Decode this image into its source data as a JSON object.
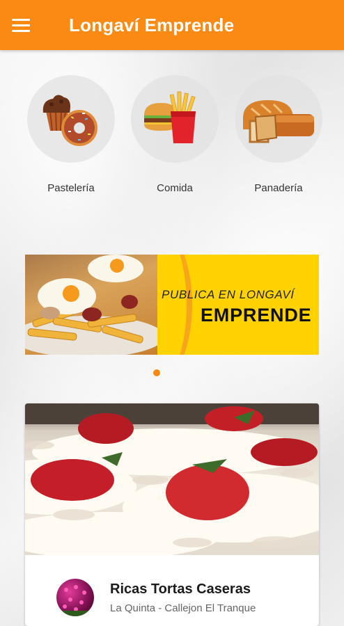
{
  "app_bar": {
    "title": "Longaví Emprende",
    "menu_icon": "hamburger-menu-icon",
    "color": "#fb8a14"
  },
  "categories": [
    {
      "label": "Pastelería",
      "icon": "pastry-icon"
    },
    {
      "label": "Comida",
      "icon": "fast-food-icon"
    },
    {
      "label": "Panadería",
      "icon": "bread-icon"
    }
  ],
  "banner": {
    "line1": "PUBLICA EN LONGAVÍ",
    "line2": "EMPRENDE",
    "background": "#ffd200"
  },
  "carousel": {
    "active_index": 0,
    "total": 1
  },
  "listing": {
    "name": "Ricas Tortas Caseras",
    "location": "La Quinta - Callejon El Tranque"
  }
}
